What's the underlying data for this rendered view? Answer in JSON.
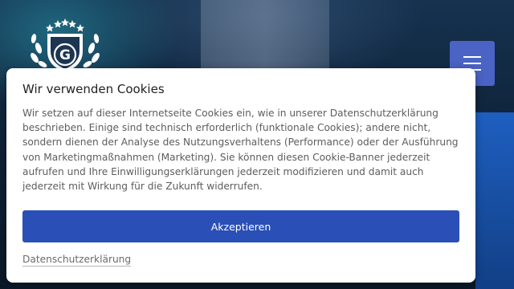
{
  "colors": {
    "accent": "#2a4fb6",
    "menu_button": "#4a63c4",
    "dialog_background": "#ffffff"
  },
  "logo": {
    "icon": "shield-laurel-logo",
    "letter": "G"
  },
  "menu": {
    "icon": "hamburger-icon"
  },
  "cookie_dialog": {
    "title": "Wir verwenden Cookies",
    "text": "Wir setzen auf dieser Internetseite Cookies ein, wie in unserer Datenschutzerklärung beschrieben. Einige sind technisch erforderlich (funktionale Cookies); andere nicht, sondern dienen der Analyse des Nutzungsverhaltens (Performance) oder der Ausführung von Marketingmaßnahmen (Marketing). Sie können diesen Cookie-Banner jederzeit aufrufen und Ihre Einwilligungserklärungen jederzeit modifizieren und damit auch jederzeit mit Wirkung für die Zukunft widerrufen.",
    "accept_label": "Akzeptieren",
    "privacy_link": "Datenschutzerklärung"
  }
}
